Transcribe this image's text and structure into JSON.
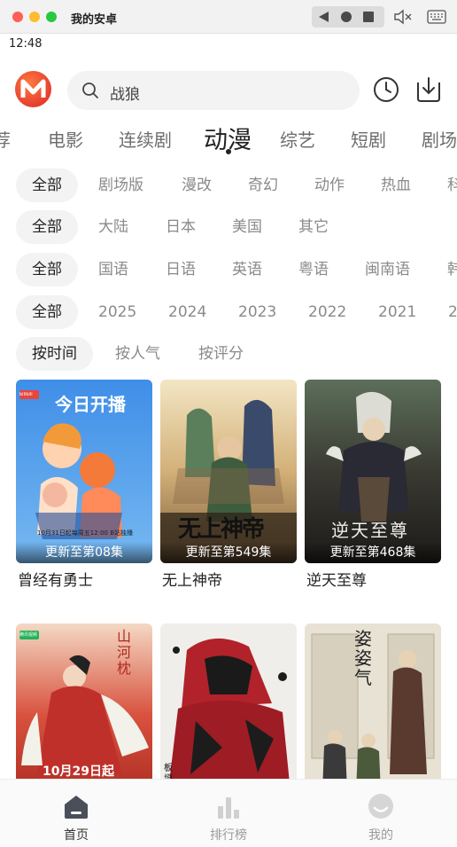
{
  "window": {
    "title": "我的安卓",
    "controls": {
      "back": "back-icon",
      "home": "home-icon",
      "recents": "recents-icon",
      "mute": "mute-icon",
      "keyboard": "keyboard-icon"
    }
  },
  "status_bar": {
    "time": "12:48"
  },
  "header": {
    "logo": "M",
    "search": {
      "text": "战狼",
      "icon": "search-icon"
    },
    "history_icon": "clock-icon",
    "download_icon": "download-icon"
  },
  "category_tabs": [
    {
      "label": "荐",
      "active": false
    },
    {
      "label": "电影",
      "active": false
    },
    {
      "label": "连续剧",
      "active": false
    },
    {
      "label": "动漫",
      "active": true
    },
    {
      "label": "综艺",
      "active": false
    },
    {
      "label": "短剧",
      "active": false
    },
    {
      "label": "剧场",
      "active": false
    }
  ],
  "filters": {
    "type": [
      "全部",
      "剧场版",
      "漫改",
      "奇幻",
      "动作",
      "热血",
      "科"
    ],
    "region": [
      "全部",
      "大陆",
      "日本",
      "美国",
      "其它"
    ],
    "language": [
      "全部",
      "国语",
      "日语",
      "英语",
      "粤语",
      "闽南语",
      "韩"
    ],
    "year": [
      "全部",
      "2025",
      "2024",
      "2023",
      "2022",
      "2021",
      "2"
    ],
    "sort": [
      "按时间",
      "按人气",
      "按评分"
    ]
  },
  "videos": [
    {
      "title": "曾经有勇士",
      "badge": "更新至第08集",
      "poster_text": "今日开播",
      "poster_subtext": "10月31日起每周五12:00 B站独播",
      "poster_corner": "bilibili"
    },
    {
      "title": "无上神帝",
      "badge": "更新至第549集",
      "poster_text": "无上神帝"
    },
    {
      "title": "逆天至尊",
      "badge": "更新至第468集",
      "poster_text": "逆天至尊"
    },
    {
      "title": "",
      "badge": "",
      "poster_text": "山河枕",
      "poster_subtext": "10月29日起",
      "poster_corner": "腾讯视频"
    },
    {
      "title": "",
      "badge": "",
      "poster_text": "板垣"
    },
    {
      "title": "",
      "badge": "",
      "poster_text": "姿姿气"
    }
  ],
  "bottom_nav": [
    {
      "label": "首页",
      "icon": "home-tab-icon",
      "active": true
    },
    {
      "label": "排行榜",
      "icon": "ranking-icon",
      "active": false
    },
    {
      "label": "我的",
      "icon": "profile-icon",
      "active": false
    }
  ],
  "colors": {
    "accent": "#222222",
    "logo": "#e8442f",
    "inactive": "#8a8a8a",
    "chip_bg": "#f3f3f3"
  }
}
